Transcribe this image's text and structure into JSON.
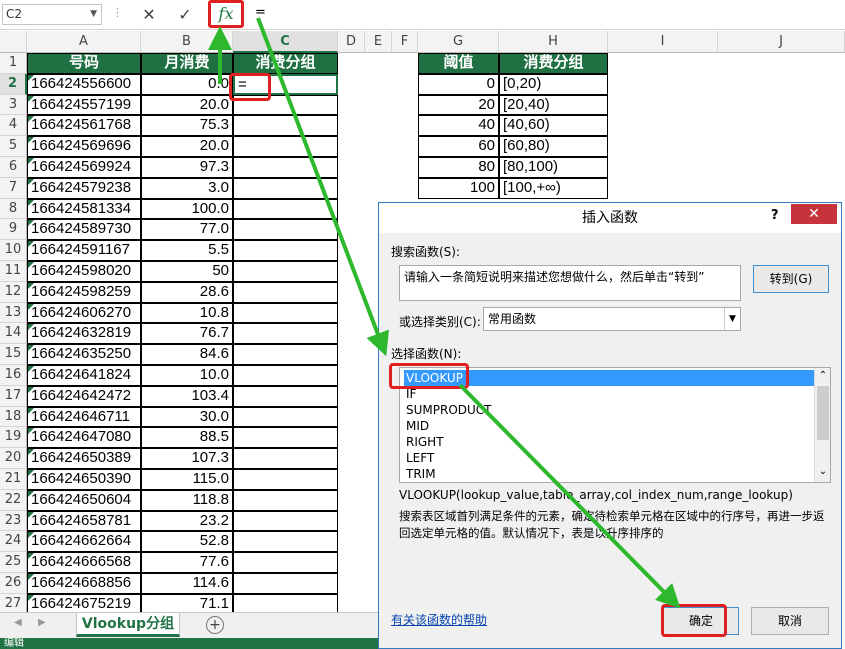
{
  "name_box": "C2",
  "formula_text": "=",
  "fx_label": "fx",
  "sheet": {
    "col_headers": [
      "A",
      "B",
      "C",
      "D",
      "E",
      "F",
      "G",
      "H",
      "I",
      "J"
    ],
    "header_row": {
      "a": "号码",
      "b": "月消费",
      "c": "消费分组",
      "g": "阈值",
      "h": "消费分组"
    },
    "active_cell_value": "=",
    "rows": [
      {
        "n": "2",
        "a": "166424556600",
        "b": "0.0"
      },
      {
        "n": "3",
        "a": "166424557199",
        "b": "20.0"
      },
      {
        "n": "4",
        "a": "166424561768",
        "b": "75.3"
      },
      {
        "n": "5",
        "a": "166424569696",
        "b": "20.0"
      },
      {
        "n": "6",
        "a": "166424569924",
        "b": "97.3"
      },
      {
        "n": "7",
        "a": "166424579238",
        "b": "3.0"
      },
      {
        "n": "8",
        "a": "166424581334",
        "b": "100.0"
      },
      {
        "n": "9",
        "a": "166424589730",
        "b": "77.0"
      },
      {
        "n": "10",
        "a": "166424591167",
        "b": "5.5"
      },
      {
        "n": "11",
        "a": "166424598020",
        "b": "50"
      },
      {
        "n": "12",
        "a": "166424598259",
        "b": "28.6"
      },
      {
        "n": "13",
        "a": "166424606270",
        "b": "10.8"
      },
      {
        "n": "14",
        "a": "166424632819",
        "b": "76.7"
      },
      {
        "n": "15",
        "a": "166424635250",
        "b": "84.6"
      },
      {
        "n": "16",
        "a": "166424641824",
        "b": "10.0"
      },
      {
        "n": "17",
        "a": "166424642472",
        "b": "103.4"
      },
      {
        "n": "18",
        "a": "166424646711",
        "b": "30.0"
      },
      {
        "n": "19",
        "a": "166424647080",
        "b": "88.5"
      },
      {
        "n": "20",
        "a": "166424650389",
        "b": "107.3"
      },
      {
        "n": "21",
        "a": "166424650390",
        "b": "115.0"
      },
      {
        "n": "22",
        "a": "166424650604",
        "b": "118.8"
      },
      {
        "n": "23",
        "a": "166424658781",
        "b": "23.2"
      },
      {
        "n": "24",
        "a": "166424662664",
        "b": "52.8"
      },
      {
        "n": "25",
        "a": "166424666568",
        "b": "77.6"
      },
      {
        "n": "26",
        "a": "166424668856",
        "b": "114.6"
      },
      {
        "n": "27",
        "a": "166424675219",
        "b": "71.1"
      }
    ],
    "lookup_table": [
      {
        "g": "0",
        "h": "[0,20)"
      },
      {
        "g": "20",
        "h": "[20,40)"
      },
      {
        "g": "40",
        "h": "[40,60)"
      },
      {
        "g": "60",
        "h": "[60,80)"
      },
      {
        "g": "80",
        "h": "[80,100)"
      },
      {
        "g": "100",
        "h": "[100,+∞)"
      }
    ],
    "row1_label": "1",
    "tab_name": "Vlookup分组",
    "status": "编辑"
  },
  "dialog": {
    "title": "插入函数",
    "help_button": "?",
    "close_button": "✕",
    "search_label": "搜索函数(S):",
    "search_value": "请输入一条简短说明来描述您想做什么，然后单击“转到”",
    "goto_button": "转到(G)",
    "category_label": "或选择类别(C):",
    "category_value": "常用函数",
    "function_list_label": "选择函数(N):",
    "functions": [
      "VLOOKUP",
      "IF",
      "SUMPRODUCT",
      "MID",
      "RIGHT",
      "LEFT",
      "TRIM"
    ],
    "signature": "VLOOKUP(lookup_value,table_array,col_index_num,range_lookup)",
    "description": "搜索表区域首列满足条件的元素，确定待检索单元格在区域中的行序号，再进一步返回选定单元格的值。默认情况下，表是以升序排序的",
    "help_link": "有关该函数的帮助",
    "ok_button": "确定",
    "cancel_button": "取消"
  },
  "colors": {
    "excel_green": "#1f7143",
    "highlight_red": "#e02020",
    "arrow_green": "#2eb82e",
    "selection_blue": "#3399ff"
  }
}
